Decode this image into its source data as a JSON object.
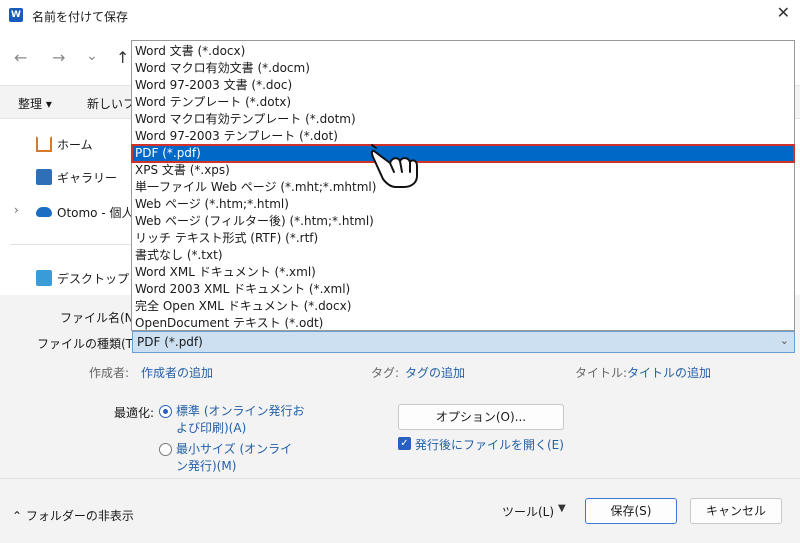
{
  "window": {
    "title": "名前を付けて保存",
    "app_icon": "W"
  },
  "nav": {
    "back": "←",
    "forward": "→",
    "down": "⌄",
    "up": "↑"
  },
  "toolbar": {
    "organize": "整理 ▾",
    "new_folder": "新しいフォ"
  },
  "sidebar": {
    "items": [
      {
        "label": "ホーム"
      },
      {
        "label": "ギャラリー"
      },
      {
        "label": "Otomo - 個人"
      },
      {
        "label": "デスクトップ"
      }
    ]
  },
  "dropdown": {
    "selected_index": 6,
    "items": [
      "Word 文書 (*.docx)",
      "Word マクロ有効文書 (*.docm)",
      "Word 97-2003 文書 (*.doc)",
      "Word テンプレート (*.dotx)",
      "Word マクロ有効テンプレート (*.dotm)",
      "Word 97-2003 テンプレート (*.dot)",
      "PDF (*.pdf)",
      "XPS 文書 (*.xps)",
      "単一ファイル Web ページ (*.mht;*.mhtml)",
      "Web ページ (*.htm;*.html)",
      "Web ページ (フィルター後) (*.htm;*.html)",
      "リッチ テキスト形式 (RTF) (*.rtf)",
      "書式なし (*.txt)",
      "Word XML ドキュメント (*.xml)",
      "Word 2003 XML ドキュメント (*.xml)",
      "完全 Open XML ドキュメント (*.docx)",
      "OpenDocument テキスト (*.odt)"
    ]
  },
  "form": {
    "filename_label": "ファイル名(N):",
    "filetype_label": "ファイルの種類(T):",
    "filetype_value": "PDF (*.pdf)",
    "author_label": "作成者:",
    "author_link": "作成者の追加",
    "tags_label": "タグ:",
    "tags_link": "タグの追加",
    "title_label": "タイトル:",
    "title_link": "タイトルの追加",
    "optimize_label": "最適化:",
    "radio_standard": "標準 (オンライン発行および印刷)(A)",
    "radio_minimum": "最小サイズ (オンライン発行)(M)",
    "options_button": "オプション(O)...",
    "open_after_publish": "発行後にファイルを開く(E)"
  },
  "footer": {
    "hide_folders": "フォルダーの非表示",
    "tools": "ツール(L)",
    "save": "保存(S)",
    "cancel": "キャンセル"
  },
  "colors": {
    "accent": "#0068c6",
    "highlight_border": "#d1312a",
    "link": "#2460a8"
  }
}
